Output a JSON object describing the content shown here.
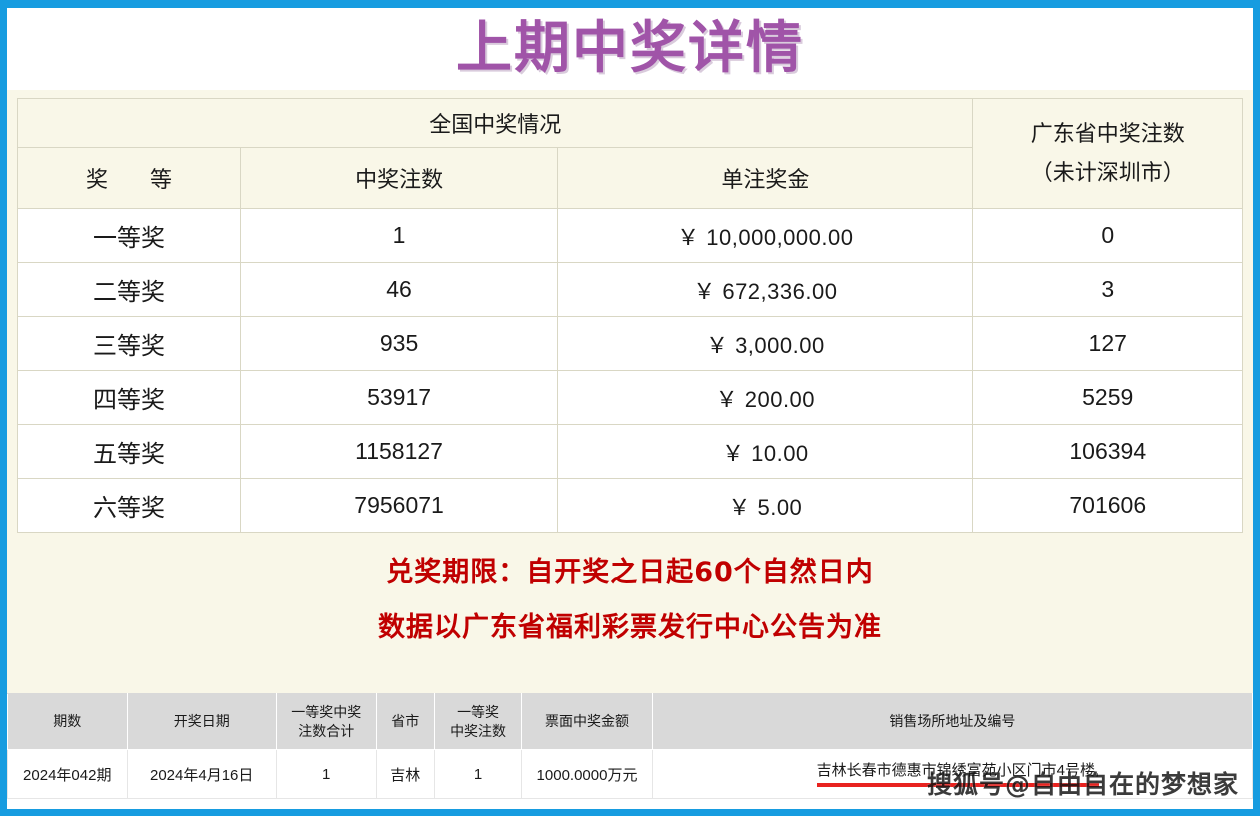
{
  "page": {
    "title": "上期中奖详情",
    "title_color": "#a054a8",
    "frame_color": "#179ce0",
    "body_background": "#f9f7e8"
  },
  "prize_table": {
    "group_headers": {
      "national": "全国中奖情况",
      "guangdong_line1": "广东省中奖注数",
      "guangdong_line2": "（未计深圳市）"
    },
    "columns": [
      "奖　等",
      "中奖注数",
      "单注奖金"
    ],
    "rows": [
      {
        "level": "一等奖",
        "national_count": "1",
        "prize_per_bet": "￥ 10,000,000.00",
        "guangdong_count": "0"
      },
      {
        "level": "二等奖",
        "national_count": "46",
        "prize_per_bet": "￥ 672,336.00",
        "guangdong_count": "3"
      },
      {
        "level": "三等奖",
        "national_count": "935",
        "prize_per_bet": "￥ 3,000.00",
        "guangdong_count": "127"
      },
      {
        "level": "四等奖",
        "national_count": "53917",
        "prize_per_bet": "￥ 200.00",
        "guangdong_count": "5259"
      },
      {
        "level": "五等奖",
        "national_count": "1158127",
        "prize_per_bet": "￥ 10.00",
        "guangdong_count": "106394"
      },
      {
        "level": "六等奖",
        "national_count": "7956071",
        "prize_per_bet": "￥ 5.00",
        "guangdong_count": "701606"
      }
    ]
  },
  "notice": {
    "color": "#c00000",
    "line1": "兑奖期限：自开奖之日起60个自然日内",
    "line2": "数据以广东省福利彩票发行中心公告为准"
  },
  "winner_table": {
    "columns": [
      "期数",
      "开奖日期",
      "一等奖中奖\n注数合计",
      "省市",
      "一等奖\n中奖注数",
      "票面中奖金额",
      "销售场所地址及编号"
    ],
    "columns_flat": {
      "issue": "期数",
      "draw_date": "开奖日期",
      "first_prize_total_line1": "一等奖中奖",
      "first_prize_total_line2": "注数合计",
      "province": "省市",
      "first_prize_count_line1": "一等奖",
      "first_prize_count_line2": "中奖注数",
      "ticket_amount": "票面中奖金额",
      "outlet_address": "销售场所地址及编号"
    },
    "rows": [
      {
        "issue": "2024年042期",
        "draw_date": "2024年4月16日",
        "first_prize_total": "1",
        "province": "吉林",
        "first_prize_count": "1",
        "ticket_amount": "1000.0000万元",
        "outlet_address": "吉林长春市德惠市锦绣富苑小区门市4号楼,",
        "address_underline_color": "#e8221f"
      }
    ]
  },
  "watermark": {
    "text": "搜狐号@自由自在的梦想家"
  }
}
